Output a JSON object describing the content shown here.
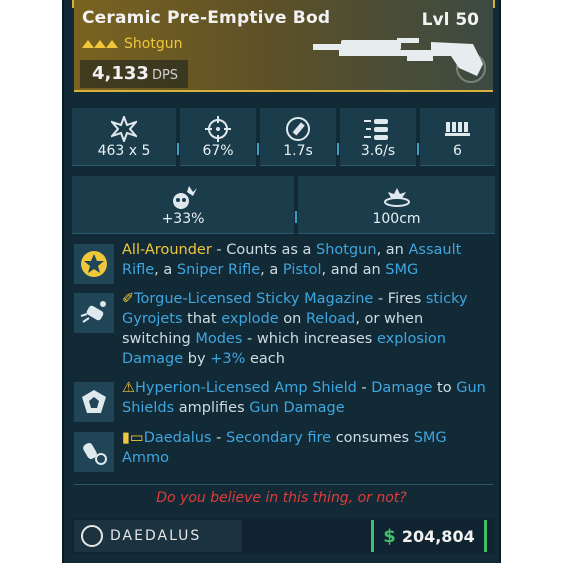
{
  "item": {
    "name": "Ceramic Pre-Emptive Bod",
    "level": "Lvl 50",
    "type": "Shotgun",
    "dps_value": "4,133",
    "dps_unit": "DPS"
  },
  "stats": [
    {
      "icon": "damage-icon",
      "value": "463 x 5"
    },
    {
      "icon": "accuracy-icon",
      "value": "67%"
    },
    {
      "icon": "reload-time-icon",
      "value": "1.7s"
    },
    {
      "icon": "fire-rate-icon",
      "value": "3.6/s"
    },
    {
      "icon": "magazine-icon",
      "value": "6"
    }
  ],
  "stats2": [
    {
      "icon": "crit-damage-icon",
      "value": "+33%"
    },
    {
      "icon": "splash-radius-icon",
      "value": "100cm"
    }
  ],
  "perks": [
    {
      "icon": "all-arounder-icon",
      "segments": [
        {
          "t": "All-Arounder",
          "c": "y"
        },
        {
          "t": " - Counts as a ",
          "c": ""
        },
        {
          "t": "Shotgun",
          "c": "b"
        },
        {
          "t": ", an ",
          "c": ""
        },
        {
          "t": "Assault Rifle",
          "c": "b"
        },
        {
          "t": ", a ",
          "c": ""
        },
        {
          "t": "Sniper Rifle",
          "c": "b"
        },
        {
          "t": ", a ",
          "c": ""
        },
        {
          "t": "Pistol",
          "c": "b"
        },
        {
          "t": ", and an ",
          "c": ""
        },
        {
          "t": "SMG",
          "c": "b"
        }
      ]
    },
    {
      "icon": "sticky-magazine-icon",
      "segments": [
        {
          "t": "Torgue-Licensed Sticky Magazine",
          "c": "b"
        },
        {
          "t": " - Fires ",
          "c": ""
        },
        {
          "t": "sticky Gyrojets",
          "c": "b"
        },
        {
          "t": " that ",
          "c": ""
        },
        {
          "t": "explode",
          "c": "b"
        },
        {
          "t": " on ",
          "c": ""
        },
        {
          "t": "Reload",
          "c": "b"
        },
        {
          "t": ", or when switching ",
          "c": ""
        },
        {
          "t": "Modes",
          "c": "b"
        },
        {
          "t": " - which increases ",
          "c": ""
        },
        {
          "t": "explosion Damage",
          "c": "b"
        },
        {
          "t": " by ",
          "c": ""
        },
        {
          "t": "+3%",
          "c": "b"
        },
        {
          "t": " each",
          "c": ""
        }
      ]
    },
    {
      "icon": "amp-shield-icon",
      "segments": [
        {
          "t": "Hyperion-Licensed Amp Shield",
          "c": "b"
        },
        {
          "t": " - ",
          "c": ""
        },
        {
          "t": "Damage",
          "c": "b"
        },
        {
          "t": " to ",
          "c": ""
        },
        {
          "t": "Gun Shields",
          "c": "b"
        },
        {
          "t": " amplifies ",
          "c": ""
        },
        {
          "t": "Gun Damage",
          "c": "b"
        }
      ]
    },
    {
      "icon": "secondary-fire-icon",
      "segments": [
        {
          "t": "Daedalus",
          "c": "b"
        },
        {
          "t": " - ",
          "c": ""
        },
        {
          "t": "Secondary fire",
          "c": "b"
        },
        {
          "t": " consumes ",
          "c": ""
        },
        {
          "t": "SMG Ammo",
          "c": "b"
        }
      ]
    }
  ],
  "flavor_text": "Do you believe in this thing, or not?",
  "manufacturer": "DAEDALUS",
  "price": {
    "currency": "$",
    "amount": "204,804"
  },
  "colors": {
    "rarity": "#f0c73a",
    "keyword": "#3ea6e0",
    "flavor": "#e23a3a",
    "price": "#3fc06a"
  }
}
